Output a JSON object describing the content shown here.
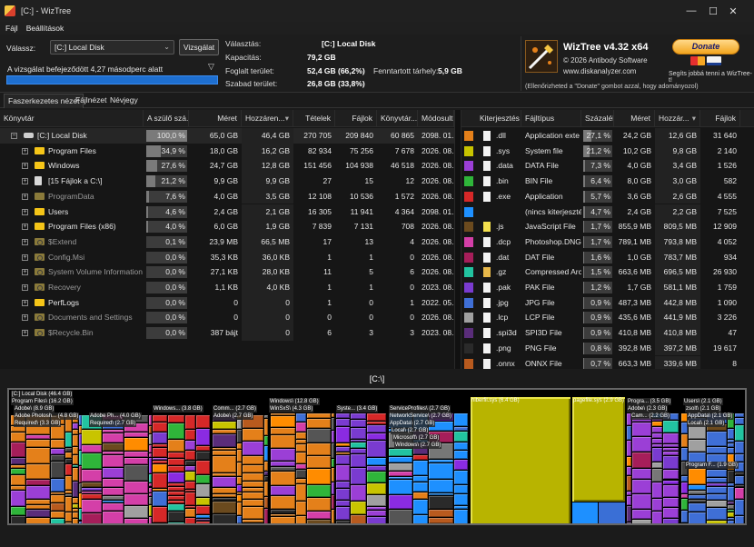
{
  "window": {
    "title": "[C:]  - WizTree",
    "minimize": "—",
    "maximize": "☐",
    "close": "✕"
  },
  "menu": [
    "Fájl",
    "Beállítások"
  ],
  "scan": {
    "select_label": "Válassz:",
    "drive": "[C:] Local Disk",
    "scan_button": "Vizsgálat",
    "status": "A vizsgálat befejeződött 4,27 másodperc alatt",
    "progress": 1.0
  },
  "info": {
    "selected_label": "Választás:",
    "selected_drive": "[C:]",
    "selected_name": "Local Disk",
    "capacity_label": "Kapacitás:",
    "capacity": "79,2 GB",
    "used_label": "Foglalt terület:",
    "used": "52,4 GB",
    "used_pct": "(66,2%)",
    "reserved_label": "Fenntartott tárhely:",
    "reserved": "5,9 GB",
    "free_label": "Szabad terület:",
    "free": "26,8 GB",
    "free_pct": "(33,8%)"
  },
  "brand": {
    "title": "WizTree v4.32 x64",
    "copyright": "© 2026 Antibody Software",
    "site": "www.diskanalyzer.com",
    "donate": "Donate",
    "donate_help": "Segíts jobbá tenni a WizTree-t!",
    "donate_note": "(Ellenőrizheted a \"Donate\" gombot azzal, hogy adományozol)"
  },
  "tabs": [
    "Faszerkezetes nézet",
    "Fájlnézet",
    "Névjegy"
  ],
  "tree": {
    "headers": [
      "Könyvtár",
      "A szülő szá...",
      "Méret",
      "Hozzáren...",
      "Tételek",
      "Fájlok",
      "Könyvtár...",
      "Módosult"
    ],
    "rows": [
      {
        "name": "[C:] Local Disk",
        "pct": "100,0 %",
        "pct_value": 1.0,
        "size": "65,0 GB",
        "alloc": "46,4 GB",
        "items": "270 705",
        "files": "209 840",
        "dirs": "60 865",
        "modified": "2098. 01. 0",
        "level": 0,
        "kind": "drive",
        "dim": false
      },
      {
        "name": "Program Files",
        "pct": "34,9 %",
        "pct_value": 0.349,
        "size": "18,0 GB",
        "alloc": "16,2 GB",
        "items": "82 934",
        "files": "75 256",
        "dirs": "7 678",
        "modified": "2026. 08. 1",
        "level": 1,
        "kind": "folder",
        "dim": false
      },
      {
        "name": "Windows",
        "pct": "27,6 %",
        "pct_value": 0.276,
        "size": "24,7 GB",
        "alloc": "12,8 GB",
        "items": "151 456",
        "files": "104 938",
        "dirs": "46 518",
        "modified": "2026. 08. 1",
        "level": 1,
        "kind": "folder",
        "dim": false
      },
      {
        "name": "[15 Fájlok a C:\\]",
        "pct": "21,2 %",
        "pct_value": 0.212,
        "size": "9,9 GB",
        "alloc": "9,9 GB",
        "items": "27",
        "files": "15",
        "dirs": "12",
        "modified": "2026. 08. 1",
        "level": 1,
        "kind": "file",
        "dim": false
      },
      {
        "name": "ProgramData",
        "pct": "7,6 %",
        "pct_value": 0.076,
        "size": "4,0 GB",
        "alloc": "3,5 GB",
        "items": "12 108",
        "files": "10 536",
        "dirs": "1 572",
        "modified": "2026. 08. 1",
        "level": 1,
        "kind": "folder",
        "dim": true
      },
      {
        "name": "Users",
        "pct": "4,6 %",
        "pct_value": 0.046,
        "size": "2,4 GB",
        "alloc": "2,1 GB",
        "items": "16 305",
        "files": "11 941",
        "dirs": "4 364",
        "modified": "2098. 01. 0",
        "level": 1,
        "kind": "folder",
        "dim": false
      },
      {
        "name": "Program Files (x86)",
        "pct": "4,0 %",
        "pct_value": 0.04,
        "size": "6,0 GB",
        "alloc": "1,9 GB",
        "items": "7 839",
        "files": "7 131",
        "dirs": "708",
        "modified": "2026. 08. 1",
        "level": 1,
        "kind": "folder",
        "dim": false
      },
      {
        "name": "$Extend",
        "pct": "0,1 %",
        "pct_value": 0.001,
        "size": "23,9 MB",
        "alloc": "66,5 MB",
        "items": "17",
        "files": "13",
        "dirs": "4",
        "modified": "2026. 08. 1",
        "level": 1,
        "kind": "sysfolder",
        "dim": true
      },
      {
        "name": "Config.Msi",
        "pct": "0,0 %",
        "pct_value": 0.0,
        "size": "35,3 KB",
        "alloc": "36,0 KB",
        "items": "1",
        "files": "1",
        "dirs": "0",
        "modified": "2026. 08. 1",
        "level": 1,
        "kind": "sysfolder",
        "dim": true
      },
      {
        "name": "System Volume Information",
        "pct": "0,0 %",
        "pct_value": 0.0,
        "size": "27,1 KB",
        "alloc": "28,0 KB",
        "items": "11",
        "files": "5",
        "dirs": "6",
        "modified": "2026. 08. 1",
        "level": 1,
        "kind": "sysfolder",
        "dim": true
      },
      {
        "name": "Recovery",
        "pct": "0,0 %",
        "pct_value": 0.0,
        "size": "1,1 KB",
        "alloc": "4,0 KB",
        "items": "1",
        "files": "1",
        "dirs": "0",
        "modified": "2023. 08. 1",
        "level": 1,
        "kind": "sysfolder",
        "dim": true
      },
      {
        "name": "PerfLogs",
        "pct": "0,0 %",
        "pct_value": 0.0,
        "size": "0",
        "alloc": "0",
        "items": "1",
        "files": "0",
        "dirs": "1",
        "modified": "2022. 05. 0",
        "level": 1,
        "kind": "folder",
        "dim": false
      },
      {
        "name": "Documents and Settings",
        "pct": "0,0 %",
        "pct_value": 0.0,
        "size": "0",
        "alloc": "0",
        "items": "0",
        "files": "0",
        "dirs": "0",
        "modified": "2026. 08. 1",
        "level": 1,
        "kind": "sysfolder",
        "dim": true
      },
      {
        "name": "$Recycle.Bin",
        "pct": "0,0 %",
        "pct_value": 0.0,
        "size": "387 bájt",
        "alloc": "0",
        "items": "6",
        "files": "3",
        "dirs": "3",
        "modified": "2023. 08. 1",
        "level": 1,
        "kind": "sysfolder",
        "dim": true
      }
    ]
  },
  "ext": {
    "headers": [
      "Kiterjesztés",
      "Fájltípus",
      "Százalék",
      "Méret",
      "Hozzár...",
      "Fájlok"
    ],
    "rows": [
      {
        "ext": ".dll",
        "type": "Application exte",
        "pct": "27,1 %",
        "pct_value": 0.271,
        "size": "24,2 GB",
        "alloc": "12,6 GB",
        "files": "31 640",
        "color": "#e4801a",
        "icon": "gear"
      },
      {
        "ext": ".sys",
        "type": "System file",
        "pct": "21,2 %",
        "pct_value": 0.212,
        "size": "10,2 GB",
        "alloc": "9,8 GB",
        "files": "2 140",
        "color": "#c8c400",
        "icon": "gear"
      },
      {
        "ext": ".data",
        "type": "DATA File",
        "pct": "7,3 %",
        "pct_value": 0.073,
        "size": "4,0 GB",
        "alloc": "3,4 GB",
        "files": "1 526",
        "color": "#9b3fd6",
        "icon": "file"
      },
      {
        "ext": ".bin",
        "type": "BIN File",
        "pct": "6,4 %",
        "pct_value": 0.064,
        "size": "8,0 GB",
        "alloc": "3,0 GB",
        "files": "582",
        "color": "#2fb53a",
        "icon": "file"
      },
      {
        "ext": ".exe",
        "type": "Application",
        "pct": "5,7 %",
        "pct_value": 0.057,
        "size": "3,6 GB",
        "alloc": "2,6 GB",
        "files": "4 555",
        "color": "#d62828",
        "icon": "app"
      },
      {
        "ext": "",
        "type": "(nincs kiterjeszté",
        "pct": "4,7 %",
        "pct_value": 0.047,
        "size": "2,4 GB",
        "alloc": "2,2 GB",
        "files": "7 525",
        "color": "#1e90ff",
        "icon": "none"
      },
      {
        "ext": ".js",
        "type": "JavaScript File",
        "pct": "1,7 %",
        "pct_value": 0.017,
        "size": "855,9 MB",
        "alloc": "809,5 MB",
        "files": "12 909",
        "color": "#6b4a1e",
        "icon": "js"
      },
      {
        "ext": ".dcp",
        "type": "Photoshop.DNG",
        "pct": "1,7 %",
        "pct_value": 0.017,
        "size": "789,1 MB",
        "alloc": "793,8 MB",
        "files": "4 052",
        "color": "#d43fa8",
        "icon": "file"
      },
      {
        "ext": ".dat",
        "type": "DAT File",
        "pct": "1,6 %",
        "pct_value": 0.016,
        "size": "1,0 GB",
        "alloc": "783,7 MB",
        "files": "934",
        "color": "#a61e5a",
        "icon": "file"
      },
      {
        "ext": ".gz",
        "type": "Compressed Arc",
        "pct": "1,5 %",
        "pct_value": 0.015,
        "size": "663,6 MB",
        "alloc": "696,5 MB",
        "files": "26 930",
        "color": "#22c4a0",
        "icon": "zip"
      },
      {
        "ext": ".pak",
        "type": "PAK File",
        "pct": "1,2 %",
        "pct_value": 0.012,
        "size": "1,7 GB",
        "alloc": "581,1 MB",
        "files": "1 759",
        "color": "#7a3bd0",
        "icon": "file"
      },
      {
        "ext": ".jpg",
        "type": "JPG File",
        "pct": "0,9 %",
        "pct_value": 0.009,
        "size": "487,3 MB",
        "alloc": "442,8 MB",
        "files": "1 090",
        "color": "#3f6fd6",
        "icon": "file"
      },
      {
        "ext": ".lcp",
        "type": "LCP File",
        "pct": "0,9 %",
        "pct_value": 0.009,
        "size": "435,6 MB",
        "alloc": "441,9 MB",
        "files": "3 226",
        "color": "#a0a0a0",
        "icon": "file"
      },
      {
        "ext": ".spi3d",
        "type": "SPI3D File",
        "pct": "0,9 %",
        "pct_value": 0.009,
        "size": "410,8 MB",
        "alloc": "410,8 MB",
        "files": "47",
        "color": "#5a2d7a",
        "icon": "file"
      },
      {
        "ext": ".png",
        "type": "PNG File",
        "pct": "0,8 %",
        "pct_value": 0.008,
        "size": "392,8 MB",
        "alloc": "397,2 MB",
        "files": "19 617",
        "color": "#2a2a2a",
        "icon": "file"
      },
      {
        "ext": ".onnx",
        "type": "ONNX File",
        "pct": "0,7 %",
        "pct_value": 0.007,
        "size": "663,3 MB",
        "alloc": "339,6 MB",
        "files": "8",
        "color": "#b85a1e",
        "icon": "file"
      }
    ]
  },
  "path_label": "[C:\\]",
  "treemap": {
    "labels": {
      "root": "[C:] Local Disk  (46.4 GB)",
      "program_files": "Program Files\\ (16.2 GB)",
      "adobe": "Adobe\\ (8.9 GB)",
      "adobe_photo": "Adobe Photosh... (4.8 GB)",
      "required1": "Required\\ (3.3 GB)",
      "adobe_ph2": "Adobe Ph... (4.0 GB)",
      "required2": "Required\\ (2.7 GB)",
      "windows_sub": "Windows... (3.8 GB)",
      "comm": "Comm... (2.7 GB)",
      "adobe2": "Adobe\\ (2.7 GB)",
      "windows": "Windows\\ (12.8 GB)",
      "winsxs": "WinSxS\\ (4.3 GB)",
      "syste": "Syste... (3.4 GB)",
      "serviceprofiles": "ServiceProfiles\\ (2.7 GB)",
      "networkservice": "NetworkService\\ (2.7 GB)",
      "appdata": "AppData\\ (2.7 GB)",
      "local": "Local\\ (2.7 GB)",
      "microsoft": "Microsoft\\ (2.7 GB)",
      "windows2": "Windows\\ (2.7 GB)",
      "hiberfil": "hiberfil.sys (6.4 GB)",
      "pagefile": "pagefile.sys (2.9 GB)",
      "progra": "Progra... (3.5 GB)",
      "adobe3": "Adobe\\ (2.3 GB)",
      "cam": "Cam... (2.2 GB)",
      "users": "Users\\ (2.1 GB)",
      "zsolt": "zsolt\\ (2.1 GB)",
      "appdata2": "AppData\\ (2.1 GB)",
      "local2": "Local\\ (2.1 GB)",
      "program_f": "Program F... (1.9 GB)"
    }
  }
}
